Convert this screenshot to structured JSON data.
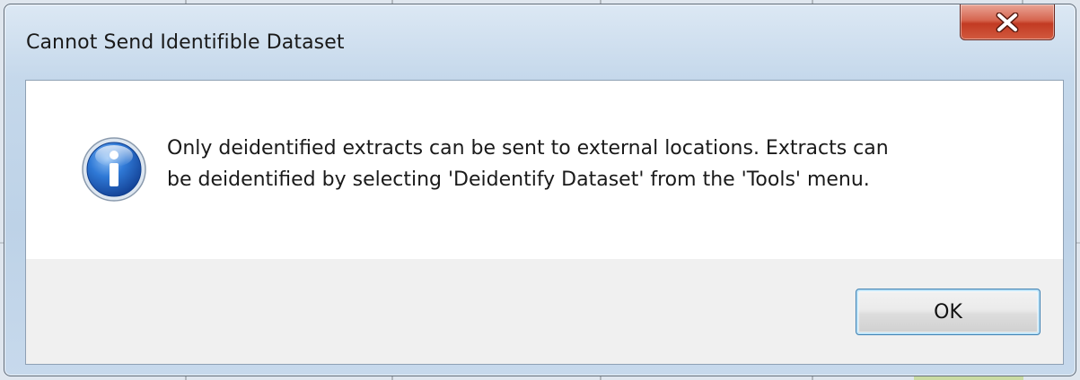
{
  "dialog": {
    "title": "Cannot Send Identifible Dataset",
    "message_lines": [
      "Only deidentified extracts can be sent to external locations. Extracts can",
      "be deidentified by selecting 'Deidentify Dataset' from the 'Tools' menu."
    ],
    "icon": "information-icon",
    "ok_label": "OK",
    "close_icon": "close-icon"
  },
  "colors": {
    "close_button": "#c94a30",
    "ok_border": "#3c7fb1",
    "info_icon_blue": "#1f63c6"
  }
}
